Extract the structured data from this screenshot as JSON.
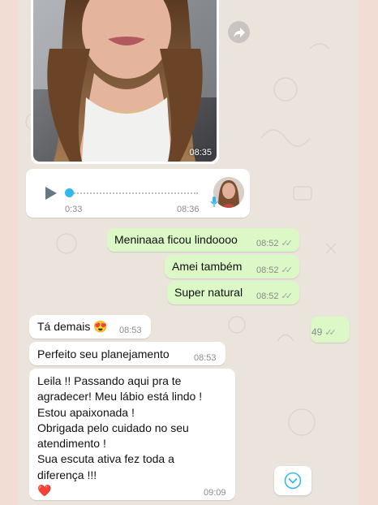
{
  "photo_message": {
    "time": "08:35"
  },
  "audio_message": {
    "elapsed": "0:33",
    "time": "08:36"
  },
  "messages_out": [
    {
      "text": "Meninaaa ficou lindoooo",
      "time": "08:52"
    },
    {
      "text": "Amei também",
      "time": "08:52"
    },
    {
      "text": "Super natural",
      "time": "08:52"
    },
    {
      "text": "",
      "time": "49"
    }
  ],
  "messages_in": [
    {
      "text": "Tá demais 😍",
      "time": "08:53"
    },
    {
      "text": "Perfeito seu planejamento",
      "time": "08:53"
    }
  ],
  "long_message": {
    "lines": [
      "Leila !! Passando aqui pra te",
      "agradecer! Meu lábio está lindo !",
      "Estou apaixonada !",
      "Obrigada pelo cuidado no seu",
      "atendimento !",
      "Sua escuta ativa fez toda a",
      "diferença !!!",
      "❤️"
    ],
    "time": "09:09"
  },
  "colors": {
    "outgoing_bubble": "#dcf8c6",
    "incoming_bubble": "#ffffff",
    "chat_background": "#ebe4dc",
    "audio_accent": "#34b7f1"
  },
  "icons": [
    "forward-icon",
    "play-icon",
    "microphone-icon",
    "double-check-icon",
    "chevron-down-icon"
  ]
}
